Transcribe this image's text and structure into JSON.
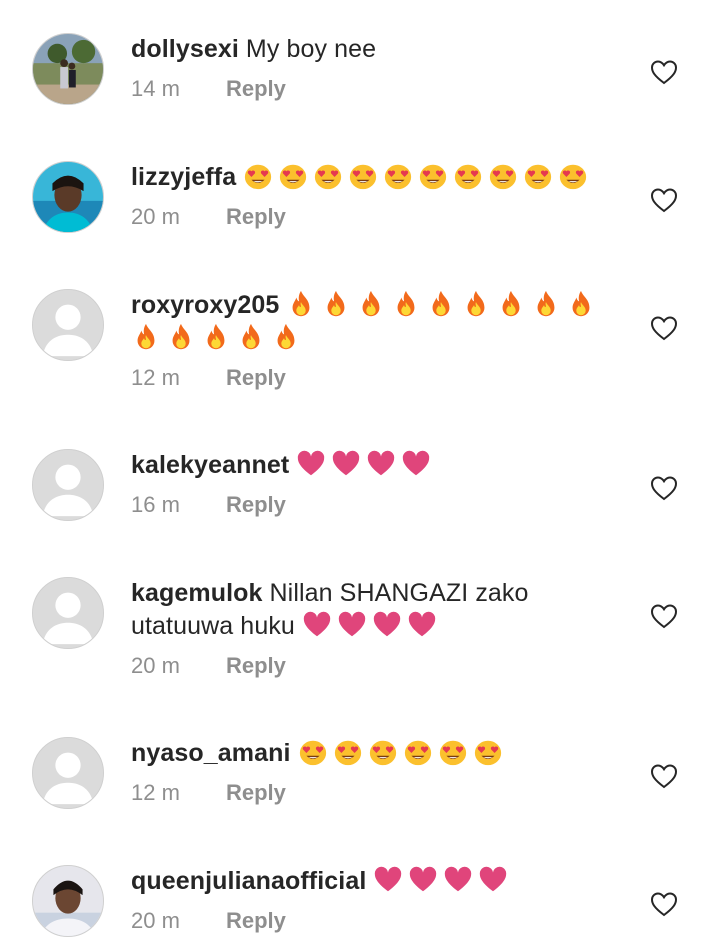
{
  "comments": [
    {
      "username": "dollysexi",
      "text": "My boy nee",
      "emoji": [],
      "emoji2": [],
      "line2": "",
      "time": "14 m",
      "reply": "Reply",
      "avatar": "photo-1",
      "like_icon": "heart-outline-icon"
    },
    {
      "username": "lizzyjeffa",
      "text": "",
      "emoji": [
        "heart-eyes",
        "heart-eyes",
        "heart-eyes",
        "heart-eyes",
        "heart-eyes",
        "heart-eyes",
        "heart-eyes",
        "heart-eyes",
        "heart-eyes",
        "heart-eyes"
      ],
      "emoji2": [],
      "line2": "",
      "time": "20 m",
      "reply": "Reply",
      "avatar": "photo-2",
      "like_icon": "heart-outline-icon"
    },
    {
      "username": "roxyroxy205",
      "text": "",
      "emoji": [
        "fire",
        "fire",
        "fire",
        "fire",
        "fire",
        "fire",
        "fire",
        "fire",
        "fire"
      ],
      "emoji2": [
        "fire",
        "fire",
        "fire",
        "fire",
        "fire"
      ],
      "line2": "",
      "time": "12 m",
      "reply": "Reply",
      "avatar": "default",
      "like_icon": "heart-outline-icon"
    },
    {
      "username": "kalekyeannet",
      "text": "",
      "emoji": [
        "pink-heart",
        "pink-heart",
        "pink-heart",
        "pink-heart"
      ],
      "emoji2": [],
      "line2": "",
      "time": "16 m",
      "reply": "Reply",
      "avatar": "default",
      "like_icon": "heart-outline-icon"
    },
    {
      "username": "kagemulok",
      "text": "Nillan SHANGAZI zako",
      "emoji": [],
      "line2": "utatuuwa huku",
      "emoji2": [
        "pink-heart",
        "pink-heart",
        "pink-heart",
        "pink-heart"
      ],
      "time": "20 m",
      "reply": "Reply",
      "avatar": "default",
      "like_icon": "heart-outline-icon"
    },
    {
      "username": "nyaso_amani",
      "text": "",
      "emoji": [
        "heart-eyes",
        "heart-eyes",
        "heart-eyes",
        "heart-eyes",
        "heart-eyes",
        "heart-eyes"
      ],
      "emoji2": [],
      "line2": "",
      "time": "12 m",
      "reply": "Reply",
      "avatar": "default",
      "like_icon": "heart-outline-icon"
    },
    {
      "username": "queenjulianaofficial",
      "text": "",
      "emoji": [
        "pink-heart",
        "pink-heart",
        "pink-heart",
        "pink-heart"
      ],
      "emoji2": [],
      "line2": "",
      "time": "20 m",
      "reply": "Reply",
      "avatar": "photo-3",
      "like_icon": "heart-outline-icon"
    }
  ],
  "colors": {
    "username": "#262626",
    "meta": "#8e8e8e",
    "pink_heart": "#e0457b",
    "fire": "#f26a1b",
    "emoji_face": "#fbc02d"
  }
}
